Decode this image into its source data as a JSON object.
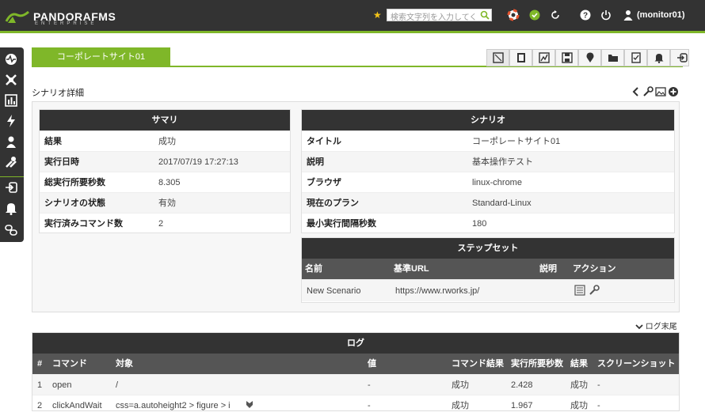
{
  "header": {
    "brand": "PANDORAFMS",
    "brand_sub": "ENTERPRISE",
    "search_placeholder": "検索文字列を入力してく",
    "username": "(monitor01)"
  },
  "tabs": {
    "active_label": "コーポレートサイト01"
  },
  "page": {
    "subtitle": "シナリオ詳細"
  },
  "summary": {
    "title": "サマリ",
    "rows": [
      {
        "key": "結果",
        "value": "成功"
      },
      {
        "key": "実行日時",
        "value": "2017/07/19 17:27:13"
      },
      {
        "key": "総実行所要秒数",
        "value": "8.305"
      },
      {
        "key": "シナリオの状態",
        "value": "有効"
      },
      {
        "key": "実行済みコマンド数",
        "value": "2"
      }
    ]
  },
  "scenario": {
    "title": "シナリオ",
    "rows": [
      {
        "key": "タイトル",
        "value": "コーポレートサイト01"
      },
      {
        "key": "説明",
        "value": "基本操作テスト"
      },
      {
        "key": "ブラウザ",
        "value": "linux-chrome"
      },
      {
        "key": "現在のプラン",
        "value": "Standard-Linux"
      },
      {
        "key": "最小実行間隔秒数",
        "value": "180"
      }
    ]
  },
  "stepset": {
    "title": "ステップセット",
    "columns": [
      "名前",
      "基準URL",
      "説明",
      "アクション"
    ],
    "rows": [
      {
        "name": "New Scenario",
        "url": "https://www.rworks.jp/",
        "desc": ""
      }
    ]
  },
  "log_link": "ログ末尾",
  "log": {
    "title": "ログ",
    "columns": [
      "#",
      "コマンド",
      "対象",
      "値",
      "コマンド結果",
      "実行所要秒数",
      "結果",
      "スクリーンショット"
    ],
    "rows": [
      {
        "n": "1",
        "cmd": "open",
        "target": "/",
        "value": "-",
        "cmd_result": "成功",
        "secs": "2.428",
        "result": "成功",
        "shot": "-"
      },
      {
        "n": "2",
        "cmd": "clickAndWait",
        "target": "css=a.autoheight2 > figure > i",
        "value": "-",
        "cmd_result": "成功",
        "secs": "1.967",
        "result": "成功",
        "shot": "-"
      }
    ]
  },
  "colors": {
    "accent": "#7fb729",
    "dark": "#333333"
  }
}
